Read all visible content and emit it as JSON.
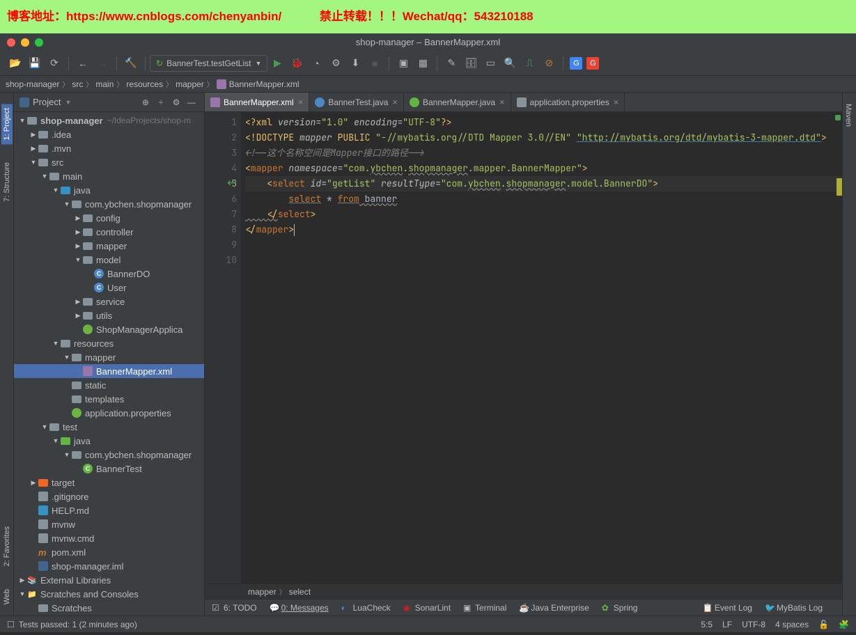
{
  "watermark": {
    "blog": "博客地址：https://www.cnblogs.com/chenyanbin/",
    "contact": "禁止转载！！！Wechat/qq：543210188"
  },
  "window": {
    "title": "shop-manager – BannerMapper.xml"
  },
  "run_config": {
    "name": "BannerTest.testGetList"
  },
  "breadcrumbs": {
    "items": [
      "shop-manager",
      "src",
      "main",
      "resources",
      "mapper",
      "BannerMapper.xml"
    ]
  },
  "side_tabs_left": {
    "structure": "7: Structure",
    "favorites": "2: Favorites",
    "project": "1: Project",
    "web": "Web"
  },
  "side_tabs_right": {
    "maven": "Maven"
  },
  "project_panel": {
    "title": "Project"
  },
  "tree": {
    "root": "shop-manager",
    "root_path": "~/IdeaProjects/shop-m",
    "idea": ".idea",
    "mvn": ".mvn",
    "src": "src",
    "main": "main",
    "java": "java",
    "pkg": "com.ybchen.shopmanager",
    "config": "config",
    "controller": "controller",
    "mapper": "mapper",
    "model": "model",
    "bannerDO": "BannerDO",
    "user": "User",
    "service": "service",
    "utils": "utils",
    "shopApp": "ShopManagerApplica",
    "resources": "resources",
    "mapper_dir": "mapper",
    "bannerMapperXml": "BannerMapper.xml",
    "static": "static",
    "templates": "templates",
    "appProps": "application.properties",
    "test": "test",
    "test_java": "java",
    "test_pkg": "com.ybchen.shopmanager",
    "bannerTest": "BannerTest",
    "target": "target",
    "gitignore": ".gitignore",
    "helpmd": "HELP.md",
    "mvnw": "mvnw",
    "mvnwcmd": "mvnw.cmd",
    "pomxml": "pom.xml",
    "shopmgriml": "shop-manager.iml",
    "extLibs": "External Libraries",
    "scratches": "Scratches and Consoles",
    "scratches_sub": "Scratches"
  },
  "tabs": [
    {
      "label": "BannerMapper.xml",
      "icon": "xml",
      "active": true
    },
    {
      "label": "BannerTest.java",
      "icon": "java",
      "active": false
    },
    {
      "label": "BannerMapper.java",
      "icon": "java",
      "active": false
    },
    {
      "label": "application.properties",
      "icon": "prop",
      "active": false
    }
  ],
  "editor": {
    "line_numbers": [
      "1",
      "2",
      "3",
      "4",
      "5",
      "6",
      "7",
      "8",
      "9",
      "10"
    ],
    "l1_xml_decl": {
      "a": "<?",
      "b": "xml",
      "c": " version",
      "d": "=",
      "e": "\"1.0\"",
      "f": " encoding",
      "g": "=",
      "h": "\"UTF-8\"",
      "i": "?>"
    },
    "l2": {
      "a": "<!DOCTYPE ",
      "b": "mapper ",
      "c": "PUBLIC ",
      "d": "\"-//mybatis.org//DTD Mapper 3.0//EN\" ",
      "e": "\"http://mybatis.org/dtd/mybatis-3-mapper.dtd\"",
      "f": ">"
    },
    "l3": "<!--这个名称空间是Mapper接口的路径-->",
    "l4": {
      "a": "<",
      "b": "mapper ",
      "c": "namespace",
      "d": "=",
      "e": "\"com.",
      "f": "ybchen",
      "g": ".",
      "h": "shopmanager",
      "i": ".mapper.BannerMapper\"",
      "j": ">"
    },
    "l5": {
      "a": "    <",
      "b": "select ",
      "c": "id",
      "d": "=",
      "e": "\"getList\"",
      "f": " resultType",
      "g": "=",
      "h": "\"com.",
      "i": "ybchen",
      "j": ".",
      "k": "shopmanager",
      "l": ".model.BannerDO\"",
      "m": ">"
    },
    "l6": {
      "a": "        ",
      "b": "select",
      "c": " * ",
      "d": "from",
      "e": " banner"
    },
    "l7": {
      "a": "    </",
      "b": "select",
      "c": ">"
    },
    "l8": {
      "a": "</",
      "b": "mapper",
      "c": ">"
    },
    "breadcrumb": {
      "a": "mapper",
      "b": "select"
    }
  },
  "tool_windows": {
    "todo": "6: TODO",
    "messages": "0: Messages",
    "luacheck": "LuaCheck",
    "sonarlint": "SonarLint",
    "terminal": "Terminal",
    "javaee": "Java Enterprise",
    "spring": "Spring",
    "eventlog": "Event Log",
    "mybatislog": "MyBatis Log"
  },
  "status_bar": {
    "msg": "Tests passed: 1 (2 minutes ago)",
    "pos": "5:5",
    "line_end": "LF",
    "encoding": "UTF-8",
    "indent": "4 spaces"
  }
}
